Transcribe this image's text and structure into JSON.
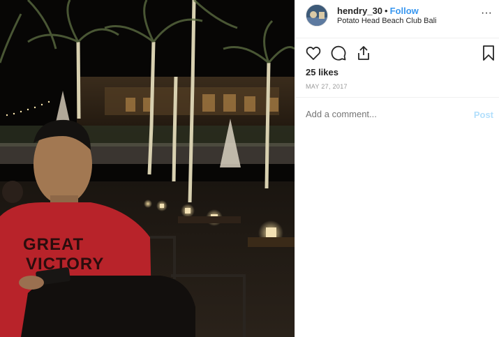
{
  "post": {
    "username": "hendry_30",
    "separator": "•",
    "follow_label": "Follow",
    "location": "Potato Head Beach Club Bali",
    "more_icon": "···",
    "likes": "25 likes",
    "date": "MAY 27, 2017",
    "comment_placeholder": "Add a comment...",
    "post_label": "Post"
  },
  "photo": {
    "shirt_text_line1": "GREAT",
    "shirt_text_line2": "VICTORY"
  },
  "icons": {
    "like": "heart-icon",
    "comment": "comment-icon",
    "share": "share-icon",
    "save": "bookmark-icon"
  },
  "colors": {
    "link": "#3897f0",
    "post_disabled": "#b2dffc",
    "muted": "#999999",
    "text": "#262626"
  }
}
